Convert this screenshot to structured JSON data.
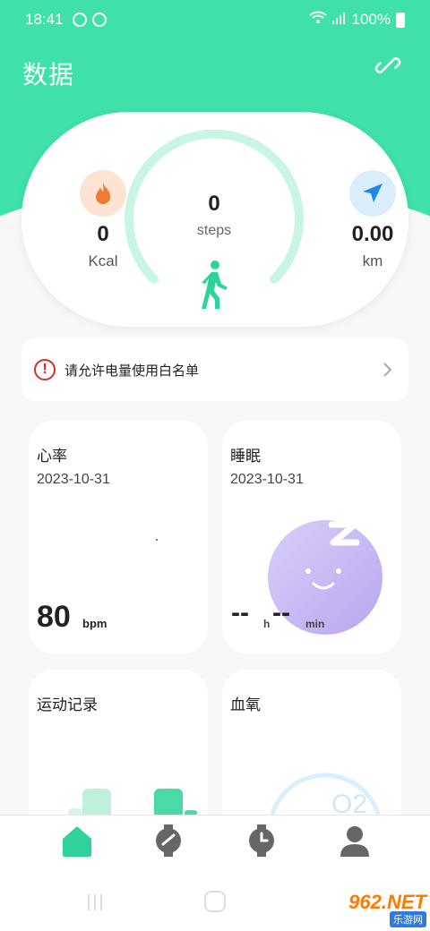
{
  "status": {
    "time": "18:41",
    "battery": "100%"
  },
  "header": {
    "title": "数据"
  },
  "summary": {
    "kcal_value": "0",
    "kcal_unit": "Kcal",
    "steps_value": "0",
    "steps_unit": "steps",
    "km_value": "0.00",
    "km_unit": "km",
    "step_progress": 0
  },
  "notice": {
    "text": "请允许电量使用白名单"
  },
  "cards": {
    "heart": {
      "title": "心率",
      "date": "2023-10-31",
      "value": "80",
      "unit": "bpm"
    },
    "sleep": {
      "title": "睡眠",
      "date": "2023-10-31",
      "hours": "--",
      "hours_unit": "h",
      "minutes": "--",
      "minutes_unit": "min"
    },
    "sport": {
      "title": "运动记录"
    },
    "oxygen": {
      "title": "血氧",
      "icon_text": "O2"
    }
  },
  "tabs": [
    {
      "name": "home",
      "active": true
    },
    {
      "name": "watch",
      "active": false
    },
    {
      "name": "clock",
      "active": false
    },
    {
      "name": "profile",
      "active": false
    }
  ],
  "watermark": {
    "line1": "962.NET",
    "line2": "乐游网"
  },
  "colors": {
    "accent": "#3fe0a9",
    "accent_light": "#c9f5e3",
    "kcal_bg": "#fde3d2",
    "kcal_fg": "#f37a33",
    "km_bg": "#dbeefc",
    "km_fg": "#1e88e5"
  }
}
